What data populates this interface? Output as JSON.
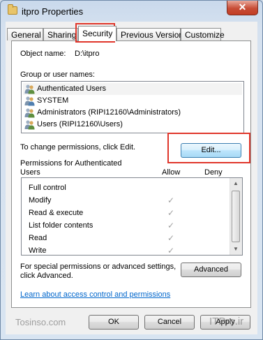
{
  "window": {
    "title": "itpro Properties",
    "close_label": "✕"
  },
  "tabs": [
    {
      "label": "General"
    },
    {
      "label": "Sharing"
    },
    {
      "label": "Security"
    },
    {
      "label": "Previous Versions"
    },
    {
      "label": "Customize"
    }
  ],
  "object": {
    "label": "Object name:",
    "value": "D:\\itpro"
  },
  "groups": {
    "label": "Group or user names:",
    "items": [
      {
        "name": "Authenticated Users"
      },
      {
        "name": "SYSTEM"
      },
      {
        "name": "Administrators (RIPI12160\\Administrators)"
      },
      {
        "name": "Users (RIPI12160\\Users)"
      }
    ]
  },
  "change_text": "To change permissions, click Edit.",
  "edit_button": "Edit...",
  "permissions": {
    "header_line1": "Permissions for Authenticated",
    "header_line2": "Users",
    "allow_label": "Allow",
    "deny_label": "Deny",
    "rows": [
      {
        "name": "Full control",
        "allow": false
      },
      {
        "name": "Modify",
        "allow": true
      },
      {
        "name": "Read & execute",
        "allow": true
      },
      {
        "name": "List folder contents",
        "allow": true
      },
      {
        "name": "Read",
        "allow": true
      },
      {
        "name": "Write",
        "allow": true
      }
    ]
  },
  "special": {
    "line1": "For special permissions or advanced settings,",
    "line2": "click Advanced.",
    "button": "Advanced"
  },
  "learn_link": "Learn about access control and permissions",
  "footer": {
    "ok": "OK",
    "cancel": "Cancel",
    "apply": "Apply"
  },
  "watermark": {
    "left": "Tosinso.com",
    "right": "ITPro.ir"
  },
  "colors": {
    "highlight_box": "#e0362b",
    "link": "#0066cc"
  }
}
